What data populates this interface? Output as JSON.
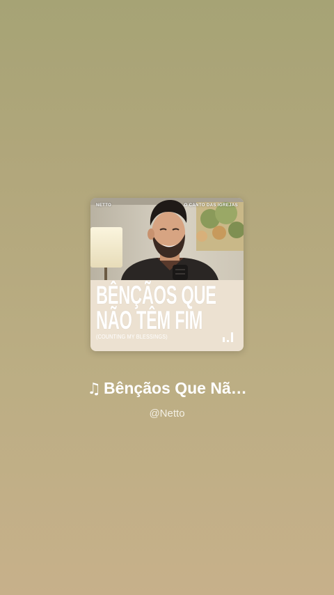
{
  "album_art": {
    "top_left": "NETTO",
    "top_right": "O CANTO DAS IGREJAS",
    "title_line1": "BÊNÇÃOS QUE",
    "title_line2": "NÃO TÊM FIM",
    "subtitle": "(COUNTING MY BLESSINGS)",
    "icon": "bars-logo-icon"
  },
  "now_playing": {
    "icon": "music-note-icon",
    "title": "Bênçãos Que Nã…",
    "artist": "@Netto"
  }
}
